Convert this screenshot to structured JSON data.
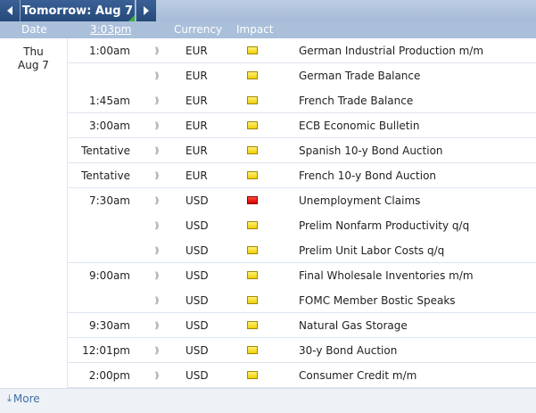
{
  "nav": {
    "title": "Tomorrow: Aug 7",
    "prev_icon": "triangle-left-icon",
    "next_icon": "triangle-right-icon"
  },
  "header": {
    "date": "Date",
    "time": "3:03pm",
    "currency": "Currency",
    "impact": "Impact"
  },
  "date": {
    "day": "Thu",
    "date": "Aug 7"
  },
  "rows": [
    {
      "time": "1:00am",
      "currency": "EUR",
      "impact": "low",
      "event": "German Industrial Production m/m"
    },
    {
      "time": "",
      "currency": "EUR",
      "impact": "low",
      "event": "German Trade Balance"
    },
    {
      "time": "1:45am",
      "currency": "EUR",
      "impact": "low",
      "event": "French Trade Balance"
    },
    {
      "time": "3:00am",
      "currency": "EUR",
      "impact": "low",
      "event": "ECB Economic Bulletin"
    },
    {
      "time": "Tentative",
      "currency": "EUR",
      "impact": "low",
      "event": "Spanish 10-y Bond Auction"
    },
    {
      "time": "Tentative",
      "currency": "EUR",
      "impact": "low",
      "event": "French 10-y Bond Auction"
    },
    {
      "time": "7:30am",
      "currency": "USD",
      "impact": "high",
      "event": "Unemployment Claims"
    },
    {
      "time": "",
      "currency": "USD",
      "impact": "low",
      "event": "Prelim Nonfarm Productivity q/q"
    },
    {
      "time": "",
      "currency": "USD",
      "impact": "low",
      "event": "Prelim Unit Labor Costs q/q"
    },
    {
      "time": "9:00am",
      "currency": "USD",
      "impact": "low",
      "event": "Final Wholesale Inventories m/m"
    },
    {
      "time": "",
      "currency": "USD",
      "impact": "low",
      "event": "FOMC Member Bostic Speaks"
    },
    {
      "time": "9:30am",
      "currency": "USD",
      "impact": "low",
      "event": "Natural Gas Storage"
    },
    {
      "time": "12:01pm",
      "currency": "USD",
      "impact": "low",
      "event": "30-y Bond Auction"
    },
    {
      "time": "2:00pm",
      "currency": "USD",
      "impact": "low",
      "event": "Consumer Credit m/m"
    }
  ],
  "colors": {
    "impact_low": "#f0cf00",
    "impact_high": "#d40000",
    "header_bg": "#aabfda",
    "nav_btn": "#26497a"
  },
  "footer": {
    "more_label": "More",
    "more_icon": "download-arrow-icon"
  }
}
